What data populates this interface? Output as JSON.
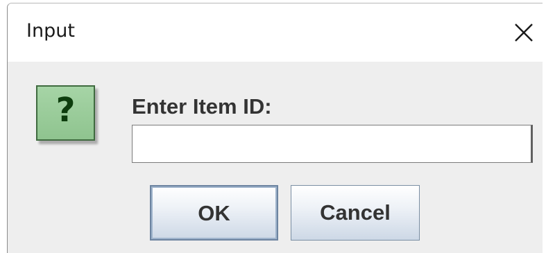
{
  "dialog": {
    "title": "Input",
    "close_icon": "close-icon",
    "question_icon": "question-icon",
    "question_glyph": "?",
    "prompt": "Enter Item ID:",
    "input_value": "",
    "buttons": {
      "ok_label": "OK",
      "cancel_label": "Cancel"
    }
  },
  "colors": {
    "title_bar": "#ffffff",
    "body": "#eeeeee",
    "icon_fill": "#a6d4a6",
    "icon_glyph": "#0d3d0d"
  }
}
